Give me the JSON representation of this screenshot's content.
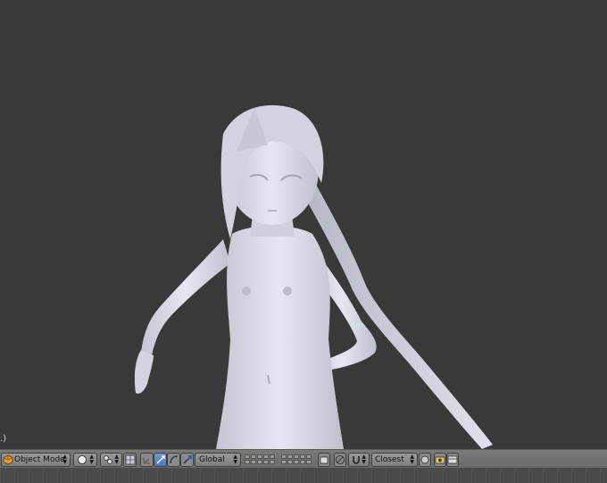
{
  "viewport": {
    "corner_text": ".)",
    "background_color": "#393939",
    "model_color": "#d9dae6"
  },
  "header": {
    "mode_select": {
      "label": "Object Mode",
      "icon": "cube-icon"
    },
    "viewport_shading": {
      "icon": "solid-sphere-icon"
    },
    "pivot_point": {
      "icon": "pivot-icon"
    },
    "manipulator_toggle": {
      "icon": "manipulator-icon"
    },
    "transform_modes": [
      "translate-icon",
      "rotate-icon",
      "scale-icon"
    ],
    "orientation_select": {
      "label": "Global"
    },
    "snap_element_select": {
      "label": "Closest"
    },
    "accent_color": "#5a82c4"
  }
}
